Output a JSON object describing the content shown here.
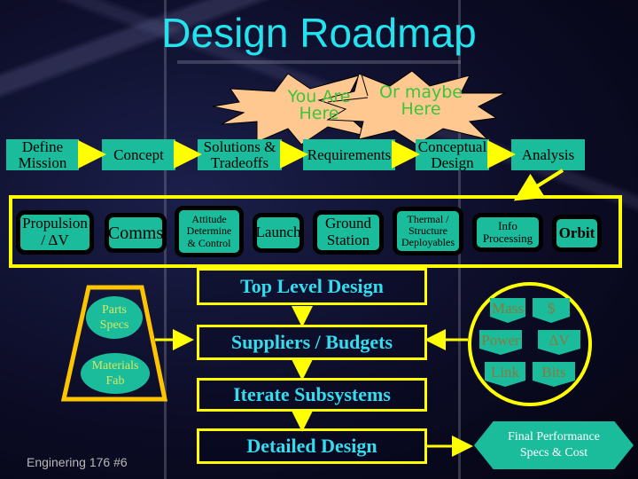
{
  "title": "Design Roadmap",
  "callouts": {
    "you_are_here": [
      "You Are",
      "Here"
    ],
    "or_maybe_here": [
      "Or maybe",
      "Here"
    ]
  },
  "process_flow": [
    {
      "label": [
        "Define",
        "Mission"
      ]
    },
    {
      "label": [
        "Concept"
      ]
    },
    {
      "label": [
        "Solutions &",
        "Tradeoffs"
      ]
    },
    {
      "label": [
        "Requirements"
      ]
    },
    {
      "label": [
        "Conceptual",
        "Design"
      ]
    },
    {
      "label": [
        "Analysis"
      ]
    }
  ],
  "subsystems": [
    {
      "label": [
        "Propulsion",
        "/ ΔV"
      ]
    },
    {
      "label": [
        "Comms"
      ]
    },
    {
      "label": [
        "Attitude",
        "Determine",
        "& Control"
      ]
    },
    {
      "label": [
        "Launch"
      ]
    },
    {
      "label": [
        "Ground",
        "Station"
      ]
    },
    {
      "label": [
        "Thermal /",
        "Structure",
        "Deployables"
      ]
    },
    {
      "label": [
        "Info",
        "Processing"
      ]
    },
    {
      "label": [
        "Orbit"
      ]
    }
  ],
  "design_steps": [
    "Top Level Design",
    "Suppliers / Budgets",
    "Iterate Subsystems",
    "Detailed Design"
  ],
  "parts": {
    "items": [
      {
        "label": [
          "Parts",
          "Specs"
        ]
      },
      {
        "label": [
          "Materials",
          "Fab"
        ]
      }
    ]
  },
  "budgets": [
    "Mass",
    "$",
    "Power",
    "ΔV",
    "Link",
    "Bits"
  ],
  "final_output": [
    "Final Performance",
    "Specs & Cost"
  ],
  "footer": "Enginering 176 #6",
  "colors": {
    "box_fill": "#1abc9c",
    "frame": "#ffff00",
    "title": "#22e3ee",
    "step_text": "#33ddee",
    "callout_fill": "#ffc890",
    "callout_text": "#3cc43c"
  }
}
